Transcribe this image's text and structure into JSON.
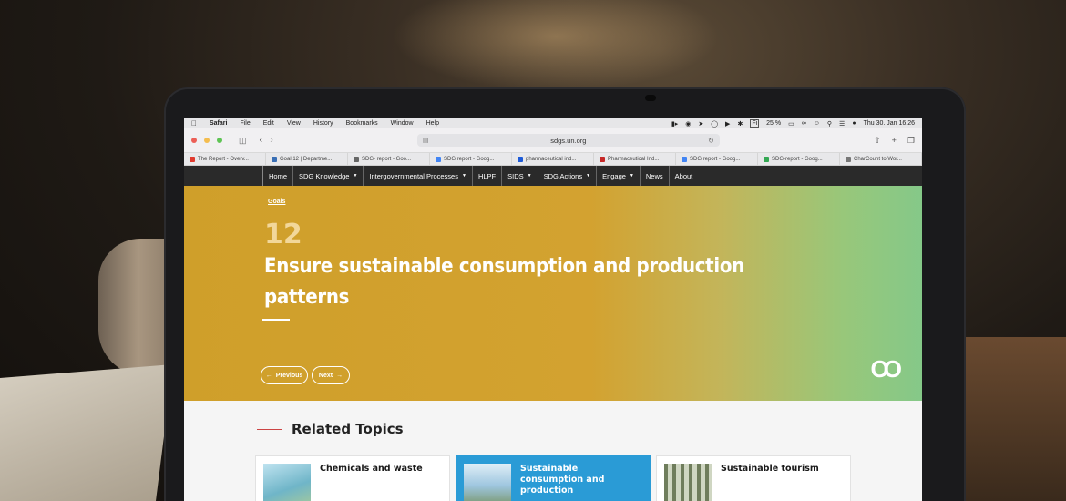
{
  "menubar": {
    "apple": "",
    "app": "Safari",
    "items": [
      "File",
      "Edit",
      "View",
      "History",
      "Bookmarks",
      "Window",
      "Help"
    ],
    "fn_label": "Fi",
    "battery": "25 %",
    "clock": "Thu 30. Jan 16.26"
  },
  "browser": {
    "url": "sdgs.un.org",
    "tabs": [
      {
        "label": "The Report - Overv...",
        "color": "#e03b2f"
      },
      {
        "label": "Goal 12 | Departme...",
        "color": "#3a6fb5"
      },
      {
        "label": "SDG- report - Goo...",
        "color": "#666666"
      },
      {
        "label": "SDG report - Goog...",
        "color": "#4285f4"
      },
      {
        "label": "pharmaceutical ind...",
        "color": "#1e5bd8"
      },
      {
        "label": "Pharmaceutical Ind...",
        "color": "#c62828"
      },
      {
        "label": "SDG report - Goog...",
        "color": "#4285f4"
      },
      {
        "label": "SDG-report - Goog...",
        "color": "#34a853"
      },
      {
        "label": "CharCount to Wor...",
        "color": "#777777"
      }
    ]
  },
  "nav": {
    "items": [
      {
        "label": "Home",
        "caret": false
      },
      {
        "label": "SDG Knowledge",
        "caret": true
      },
      {
        "label": "Intergovernmental Processes",
        "caret": true
      },
      {
        "label": "HLPF",
        "caret": false
      },
      {
        "label": "SIDS",
        "caret": true
      },
      {
        "label": "SDG Actions",
        "caret": true
      },
      {
        "label": "Engage",
        "caret": true
      },
      {
        "label": "News",
        "caret": false
      },
      {
        "label": "About",
        "caret": false
      }
    ]
  },
  "hero": {
    "breadcrumb": "Goals",
    "goal_number": "12",
    "title": "Ensure sustainable consumption and production patterns",
    "previous_label": "Previous",
    "next_label": "Next",
    "logo_icon": "infinity-loop-icon",
    "accent": "#d3a230"
  },
  "related": {
    "title": "Related Topics",
    "cards": [
      {
        "label": "Chemicals and waste",
        "active": false
      },
      {
        "label": "Sustainable consumption and production",
        "active": true
      },
      {
        "label": "Sustainable tourism",
        "active": false
      }
    ]
  }
}
